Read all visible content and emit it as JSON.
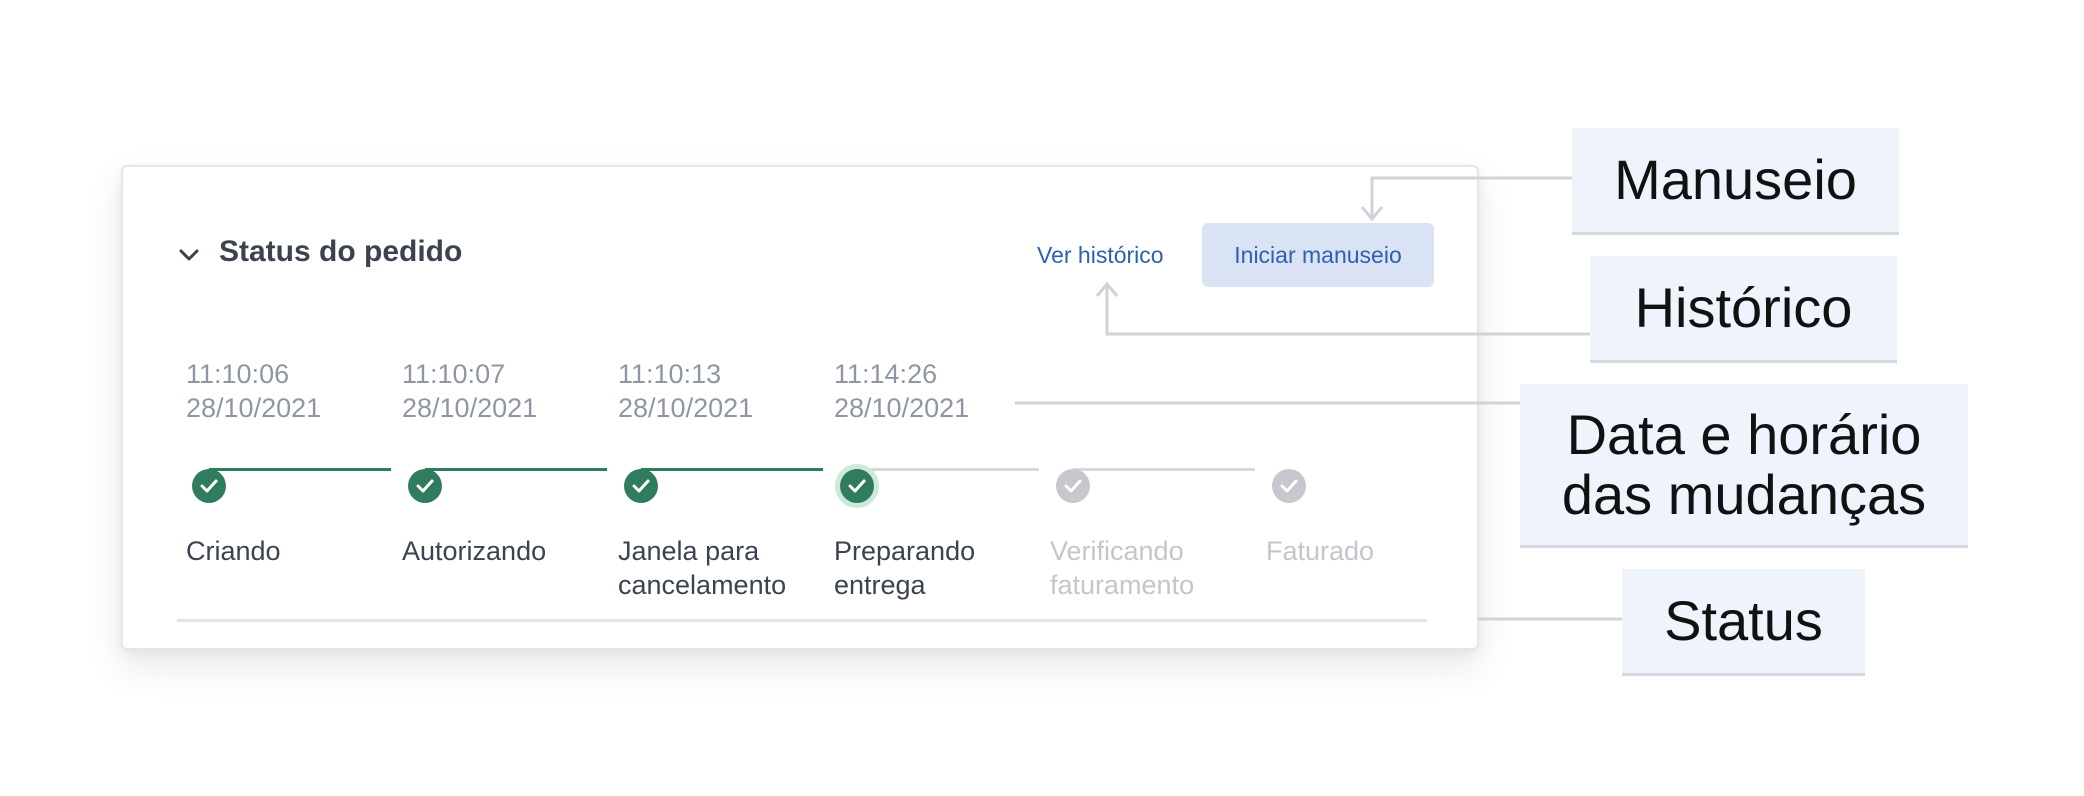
{
  "card": {
    "title": "Status do pedido",
    "history_link": "Ver histórico",
    "handle_button": "Iniciar manuseio"
  },
  "timeline": {
    "steps": [
      {
        "time": "11:10:06",
        "date": "28/10/2021",
        "label_line1": "Criando",
        "label_line2": "",
        "state": "done"
      },
      {
        "time": "11:10:07",
        "date": "28/10/2021",
        "label_line1": "Autorizando",
        "label_line2": "",
        "state": "done"
      },
      {
        "time": "11:10:13",
        "date": "28/10/2021",
        "label_line1": "Janela para",
        "label_line2": "cancelamento",
        "state": "done"
      },
      {
        "time": "11:14:26",
        "date": "28/10/2021",
        "label_line1": "Preparando",
        "label_line2": "entrega",
        "state": "current"
      },
      {
        "time": "",
        "date": "",
        "label_line1": "Verificando",
        "label_line2": "faturamento",
        "state": "pending"
      },
      {
        "time": "",
        "date": "",
        "label_line1": "Faturado",
        "label_line2": "",
        "state": "pending"
      }
    ]
  },
  "annotations": {
    "manuseio": "Manuseio",
    "historico": "Histórico",
    "data_line1": "Data e horário",
    "data_line2": "das mudanças",
    "status": "Status"
  },
  "colors": {
    "done": "#2f7c5e",
    "current_ring": "#cfe9d9",
    "pending": "#c6c8ce",
    "link": "#2e5fb0",
    "button_bg": "#d9e3f4",
    "callout_bg": "#eff3fb",
    "connector": "#d0d3d9"
  },
  "icons": {
    "collapse": "chevron-down-icon",
    "step": "check-icon"
  }
}
